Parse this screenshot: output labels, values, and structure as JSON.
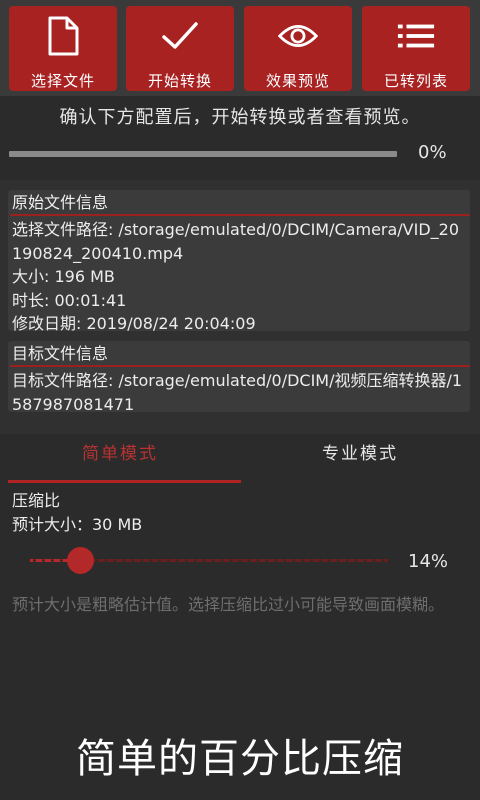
{
  "toolbar": {
    "buttons": [
      {
        "label": "选择文件",
        "icon": "file-icon"
      },
      {
        "label": "开始转换",
        "icon": "check-icon"
      },
      {
        "label": "效果预览",
        "icon": "eye-icon"
      },
      {
        "label": "已转列表",
        "icon": "list-icon"
      }
    ],
    "accent_color": "#a82222"
  },
  "hint": "确认下方配置后，开始转换或者查看预览。",
  "progress": {
    "value": 0,
    "text": "0%"
  },
  "source_info": {
    "title": "原始文件信息",
    "path": "选择文件路径: /storage/emulated/0/DCIM/Camera/VID_20190824_200410.mp4",
    "size": "大小: 196 MB",
    "duration": "时长: 00:01:41",
    "modified": "修改日期: 2019/08/24 20:04:09"
  },
  "target_info": {
    "title": "目标文件信息",
    "path": "目标文件路径: /storage/emulated/0/DCIM/视频压缩转换器/1587987081471"
  },
  "tabs": [
    {
      "label": "简单模式",
      "active": true
    },
    {
      "label": "专业模式",
      "active": false
    }
  ],
  "simple_mode": {
    "ratio_label": "压缩比",
    "estimated_size": "预计大小：30 MB",
    "slider_value": 14,
    "slider_text": "14%",
    "note": "预计大小是粗略估计值。选择压缩比过小可能导致画面模糊。"
  },
  "caption": "简单的百分比压缩"
}
